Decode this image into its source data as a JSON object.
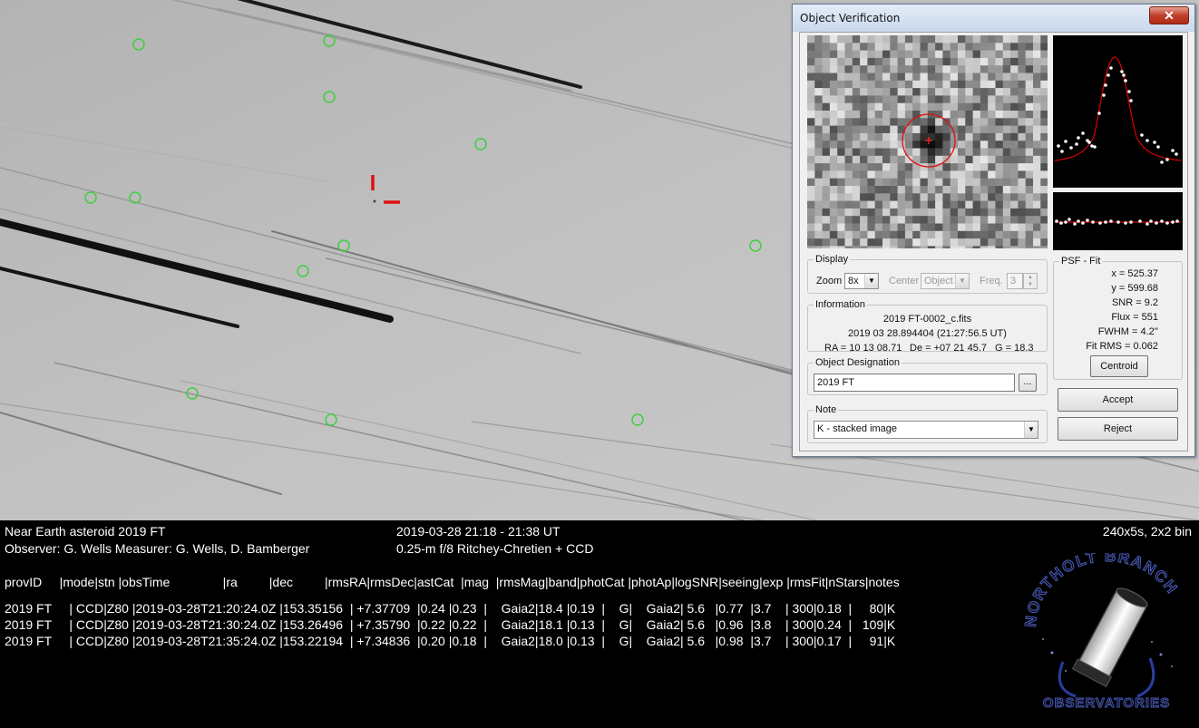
{
  "dialog": {
    "title": "Object Verification",
    "close_label": "✕",
    "display": {
      "legend": "Display",
      "zoom_label": "Zoom",
      "zoom_value": "8x",
      "center_label": "Center",
      "center_value": "Object",
      "freq_label": "Freq.",
      "freq_value": "3"
    },
    "information": {
      "legend": "Information",
      "filename": "2019 FT-0002_c.fits",
      "date": "2019 03 28.894404 (21:27:56.5 UT)",
      "ra": "RA = 10 13 08.71",
      "de": "De = +07 21 45.7",
      "g": "G = 18.3"
    },
    "designation": {
      "legend": "Object Designation",
      "value": "2019 FT",
      "browse_label": "..."
    },
    "note": {
      "legend": "Note",
      "value": "K - stacked image"
    },
    "psf_fit": {
      "legend": "PSF - Fit",
      "x": "x = 525.37",
      "y": "y = 599.68",
      "snr": "SNR = 9.2",
      "flux": "Flux = 551",
      "fwhm": "FWHM = 4.2''",
      "fit_rms": "Fit RMS = 0.062",
      "centroid_label": "Centroid"
    },
    "accept_label": "Accept",
    "reject_label": "Reject"
  },
  "caption": {
    "object": "Near Earth asteroid 2019 FT",
    "observer": "Observer: G. Wells   Measurer: G. Wells, D. Bamberger",
    "time_range": "2019-03-28 21:18 - 21:38 UT",
    "telescope": "0.25-m f/8 Ritchey-Chretien + CCD",
    "exposure": "240x5s, 2x2 bin"
  },
  "table": {
    "header": "provID     |mode|stn |obsTime               |ra         |dec         |rmsRA|rmsDec|astCat  |mag  |rmsMag|band|photCat |photAp|logSNR|seeing|exp |rmsFit|nStars|notes",
    "rows": [
      "2019 FT     | CCD|Z80 |2019-03-28T21:20:24.0Z |153.35156  | +7.37709  |0.24 |0.23  |    Gaia2|18.4 |0.19  |    G|    Gaia2| 5.6   |0.77  |3.7    | 300|0.18  |     80|K",
      "2019 FT     | CCD|Z80 |2019-03-28T21:30:24.0Z |153.26496  | +7.35790  |0.22 |0.22  |    Gaia2|18.1 |0.13  |    G|    Gaia2| 5.6   |0.96  |3.8    | 300|0.24  |   109|K",
      "2019 FT     | CCD|Z80 |2019-03-28T21:35:24.0Z |153.22194  | +7.34836  |0.20 |0.18  |    Gaia2|18.0 |0.13  |    G|    Gaia2| 5.6   |0.98  |3.7    | 300|0.17  |     91|K"
    ]
  },
  "logo": {
    "top_text": "NORTHOLT BRANCH",
    "bottom_text": "OBSERVATORIES"
  },
  "colors": {
    "marker_green": "#3ecf3e",
    "target_red": "#e01010",
    "psf_curve": "#e00000"
  },
  "icons": {
    "close": "close-icon",
    "combo_arrow": "chevron-down-icon"
  }
}
